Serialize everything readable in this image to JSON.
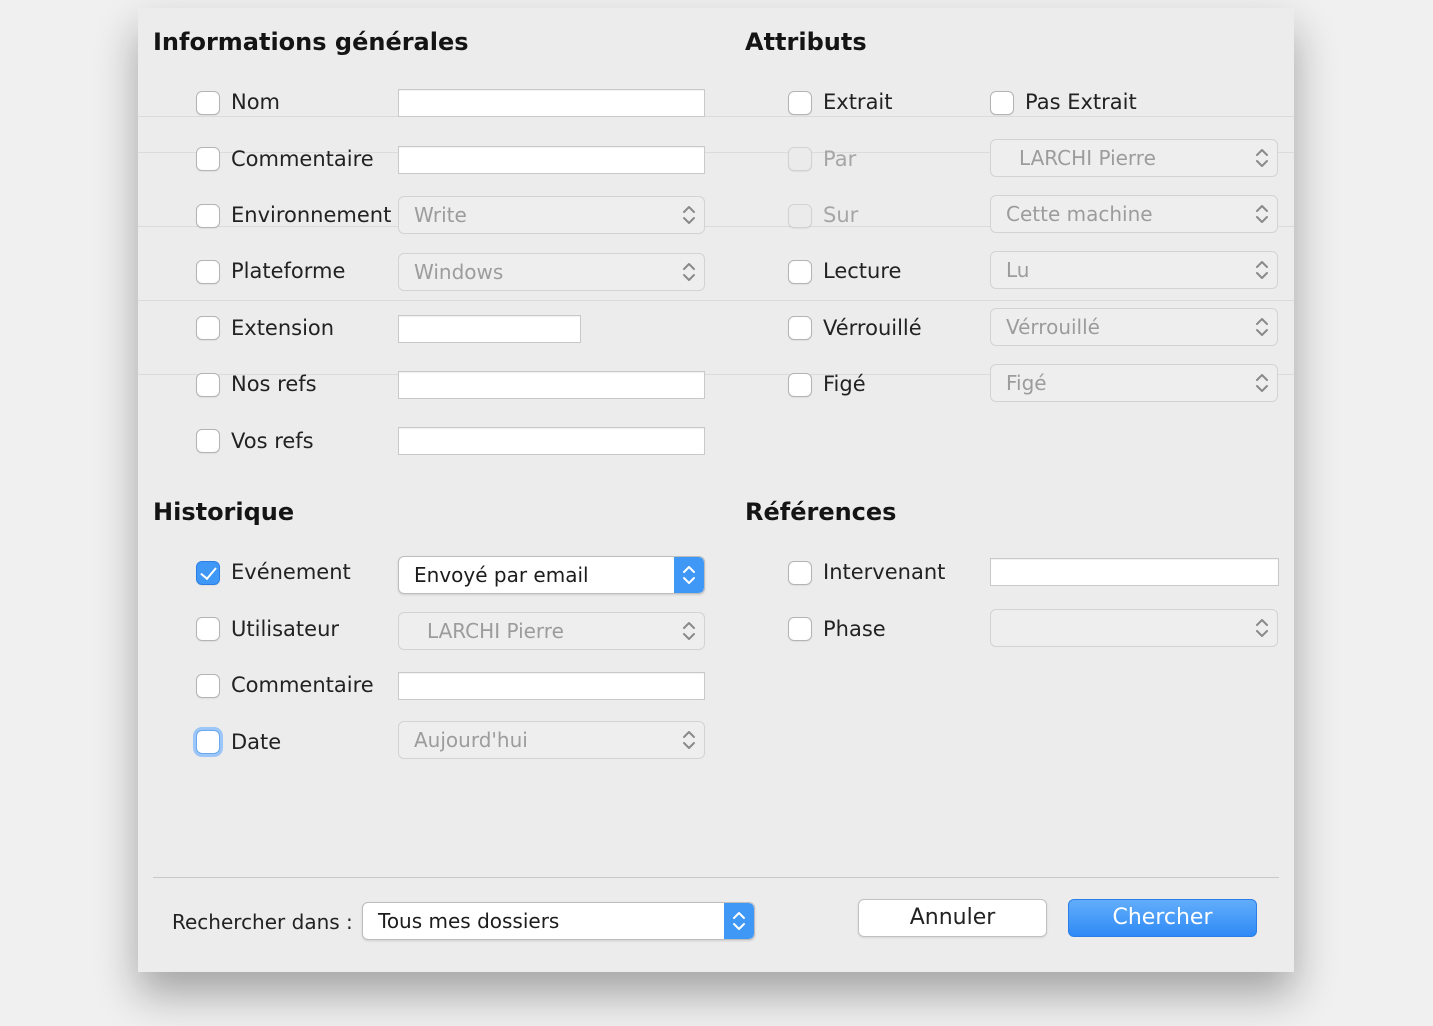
{
  "sections": {
    "general": "Informations générales",
    "attributes": "Attributs",
    "history": "Historique",
    "references": "Références"
  },
  "general": {
    "nom": "Nom",
    "commentaire": "Commentaire",
    "environnement": "Environnement",
    "environnement_value": "Write",
    "plateforme": "Plateforme",
    "plateforme_value": "Windows",
    "extension": "Extension",
    "nos_refs": "Nos refs",
    "vos_refs": "Vos refs"
  },
  "attributes": {
    "extrait": "Extrait",
    "pas_extrait": "Pas Extrait",
    "par": "Par",
    "par_value": "LARCHI Pierre",
    "sur": "Sur",
    "sur_value": "Cette machine",
    "lecture": "Lecture",
    "lecture_value": "Lu",
    "verrouille": "Vérrouillé",
    "verrouille_value": "Vérrouillé",
    "fige": "Figé",
    "fige_value": "Figé"
  },
  "history": {
    "evenement": "Evénement",
    "evenement_value": "Envoyé par email",
    "utilisateur": "Utilisateur",
    "utilisateur_value": "LARCHI Pierre",
    "commentaire": "Commentaire",
    "date": "Date",
    "date_value": "Aujourd'hui"
  },
  "references": {
    "intervenant": "Intervenant",
    "phase": "Phase",
    "phase_value": ""
  },
  "footer": {
    "search_in_label": "Rechercher dans :",
    "search_in_value": "Tous mes dossiers",
    "cancel": "Annuler",
    "search": "Chercher"
  },
  "colors": {
    "accent": "#3f97f6",
    "background": "#ececec"
  }
}
